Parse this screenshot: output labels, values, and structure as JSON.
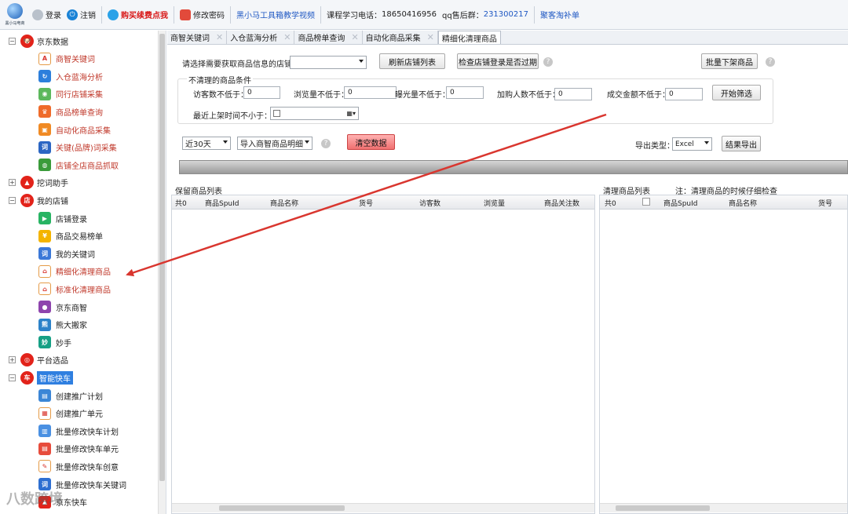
{
  "toolbar": {
    "logo_text": "黑小马电商",
    "login": "登录",
    "logout": "注销",
    "buy_points": "购买续费点我",
    "change_password": "修改密码",
    "tutorial_video": "黑小马工具箱教学视频",
    "course_phone_label": "课程学习电话：",
    "course_phone": "18650416956",
    "qq_label": "qq售后群：",
    "qq_group": "231300217",
    "fill_orders": "聚客淘补单"
  },
  "sidebar": {
    "groups": [
      {
        "label": "京东数据",
        "icon": "jd-icon",
        "expanded": true,
        "items": [
          {
            "label": "商智关键词",
            "icon": "font-aa-icon"
          },
          {
            "label": "入仓蓝海分析",
            "icon": "chart-cycle-icon"
          },
          {
            "label": "同行店铺采集",
            "icon": "eye-icon"
          },
          {
            "label": "商品榜单查询",
            "icon": "trophy-icon"
          },
          {
            "label": "自动化商品采集",
            "icon": "cart-icon"
          },
          {
            "label": "关键(品牌)词采集",
            "icon": "word-icon"
          },
          {
            "label": "店铺全店商品抓取",
            "icon": "globe-icon"
          }
        ]
      },
      {
        "label": "挖词助手",
        "icon": "mountain-icon",
        "expanded": false,
        "items": []
      },
      {
        "label": "我的店铺",
        "icon": "shop-icon",
        "expanded": true,
        "items": [
          {
            "label": "店铺登录",
            "icon": "login-icon"
          },
          {
            "label": "商品交易榜单",
            "icon": "coin-icon"
          },
          {
            "label": "我的关键词",
            "icon": "keyword-icon"
          },
          {
            "label": "精细化清理商品",
            "icon": "clean-icon"
          },
          {
            "label": "标准化清理商品",
            "icon": "clean-icon"
          },
          {
            "label": "京东商智",
            "icon": "jd-brain-icon"
          },
          {
            "label": "熊大搬家",
            "icon": "bear-icon"
          },
          {
            "label": "妙手",
            "icon": "miaoshou-icon"
          }
        ]
      },
      {
        "label": "平台选品",
        "icon": "target-icon",
        "expanded": false,
        "items": []
      },
      {
        "label": "智能快车",
        "icon": "car-icon",
        "expanded": true,
        "items": [
          {
            "label": "创建推广计划",
            "icon": "plan-icon"
          },
          {
            "label": "创建推广单元",
            "icon": "unit-icon"
          },
          {
            "label": "批量修改快车计划",
            "icon": "batch-plan-icon"
          },
          {
            "label": "批量修改快车单元",
            "icon": "batch-unit-icon"
          },
          {
            "label": "批量修改快车创意",
            "icon": "creative-icon"
          },
          {
            "label": "批量修改快车关键词",
            "icon": "batch-keyword-icon"
          },
          {
            "label": "京东快车",
            "icon": "jd-car-icon"
          }
        ]
      }
    ]
  },
  "tabs": [
    {
      "label": "商智关键词",
      "active": false
    },
    {
      "label": "入仓蓝海分析",
      "active": false
    },
    {
      "label": "商品榜单查询",
      "active": false
    },
    {
      "label": "自动化商品采集",
      "active": false
    },
    {
      "label": "精细化清理商品",
      "active": true
    }
  ],
  "main": {
    "select_shop_label": "请选择需要获取商品信息的店铺：",
    "select_shop_value": "",
    "refresh_shop_button": "刷新店铺列表",
    "check_login_button": "检查店铺登录是否过期",
    "batch_offshelf_button": "批量下架商品",
    "conditions_title": "不清理的商品条件",
    "visitors_label": "访客数不低于：",
    "visitors_value": "0",
    "views_label": "浏览量不低于：",
    "views_value": "0",
    "exposure_label": "曝光量不低于：",
    "exposure_value": "0",
    "cart_label": "加购人数不低于：",
    "cart_value": "0",
    "amount_label": "成交金额不低于：",
    "amount_value": "0",
    "start_filter_button": "开始筛选",
    "listing_time_label": "最近上架时间不小于：",
    "range_value": "近30天",
    "import_value": "导入商智商品明细",
    "clear_button": "清空数据",
    "export_type_label": "导出类型：",
    "export_type_value": "Excel",
    "export_button": "结果导出",
    "keep_panel_title": "保留商品列表",
    "keep_columns": [
      "共0",
      "商品SpuId",
      "商品名称",
      "货号",
      "访客数",
      "浏览量",
      "商品关注数"
    ],
    "clean_panel_title": "清理商品列表",
    "clean_note": "注：清理商品的时候仔细检查",
    "clean_columns": [
      "共0",
      "",
      "商品SpuId",
      "商品名称",
      "货号"
    ]
  },
  "watermark": "八数跨境",
  "colors": {
    "accent_red": "#d9362f",
    "link_blue": "#1f58c3",
    "highlight": "#d5ebff"
  }
}
